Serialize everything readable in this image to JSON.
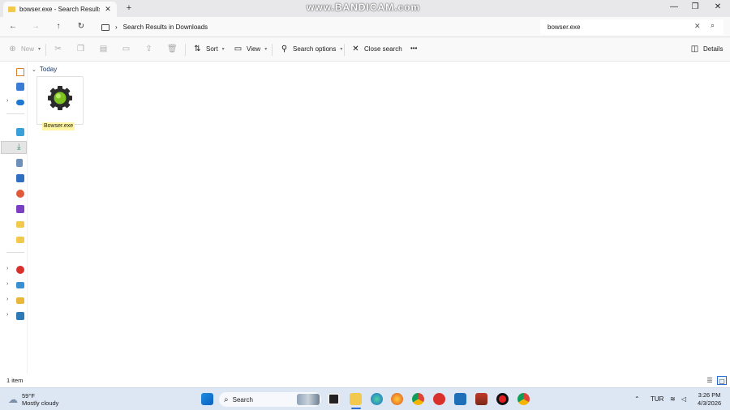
{
  "window": {
    "tab_title": "bowser.exe - Search Results in",
    "tab_close": "✕",
    "new_tab": "+",
    "watermark": "www.BANDICAM.com",
    "minimize": "—",
    "maximize": "❐",
    "close": "✕"
  },
  "nav": {
    "back": "←",
    "forward": "→",
    "up": "↑",
    "refresh": "↻",
    "breadcrumb_sep": "›",
    "location": "Search Results in Downloads",
    "search_value": "bowser.exe",
    "search_clear": "✕",
    "search_icon": "⌕"
  },
  "toolbar": {
    "new_label": "New",
    "sort_label": "Sort",
    "view_label": "View",
    "search_options_label": "Search options",
    "close_search_label": "Close search",
    "more_label": "•••",
    "details_label": "Details"
  },
  "content": {
    "group_label": "Today",
    "files": [
      {
        "name": "Bowser.exe",
        "icon": "gear-icon"
      }
    ]
  },
  "status": {
    "item_count": "1 item"
  },
  "taskbar": {
    "temperature": "59°F",
    "condition": "Mostly cloudy",
    "search_label": "Search",
    "language": "TUR",
    "time": "3:26 PM",
    "date": "4/3/2026"
  },
  "colors": {
    "accent": "#2a6dd4",
    "selection_highlight": "#fff6a3",
    "gear_green": "#7dc21e"
  }
}
